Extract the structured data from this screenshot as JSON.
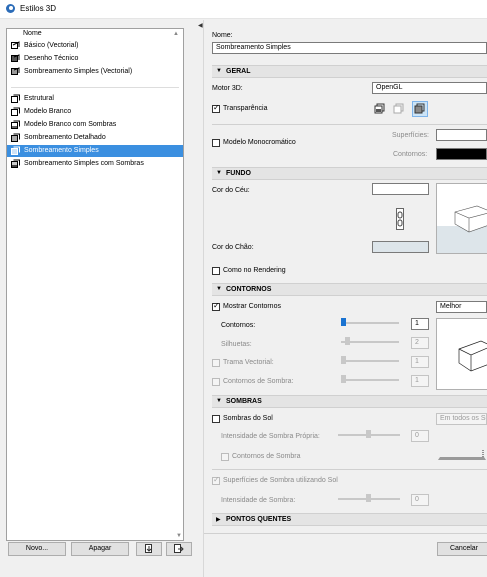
{
  "window": {
    "title": "Estilos 3D"
  },
  "sidebar": {
    "header": "Nome",
    "groups": [
      [
        {
          "label": "Básico (Vectorial)",
          "icon": "vector-style-icon"
        },
        {
          "label": "Desenho Técnico",
          "icon": "technical-drawing-icon"
        },
        {
          "label": "Sombreamento Simples (Vectorial)",
          "icon": "vector-shading-icon"
        }
      ],
      [
        {
          "label": "Estrutural",
          "icon": "structural-icon"
        },
        {
          "label": "Modelo Branco",
          "icon": "white-model-icon"
        },
        {
          "label": "Modelo Branco com Sombras",
          "icon": "white-model-shadows-icon"
        },
        {
          "label": "Sombreamento Detalhado",
          "icon": "detailed-shading-icon"
        },
        {
          "label": "Sombreamento Simples",
          "icon": "simple-shading-icon",
          "selected": true
        },
        {
          "label": "Sombreamento Simples com Sombras",
          "icon": "simple-shading-shadows-icon"
        }
      ]
    ],
    "buttons": {
      "new": "Novo...",
      "delete": "Apagar"
    }
  },
  "settings": {
    "name_label": "Nome:",
    "name_value": "Sombreamento Simples",
    "geral": {
      "title": "GERAL",
      "engine_label": "Motor 3D:",
      "engine_value": "OpenGL",
      "transparency_label": "Transparência",
      "transparency_checked": true,
      "mono_label": "Modelo Monocromático",
      "mono_checked": false,
      "surfaces_label": "Superfícies:",
      "contours_label": "Contornos:"
    },
    "fundo": {
      "title": "FUNDO",
      "sky_label": "Cor do Céu:",
      "ground_label": "Cor do Chão:",
      "as_rendering_label": "Como no Rendering"
    },
    "contornos": {
      "title": "CONTORNOS",
      "show_label": "Mostrar Contornos",
      "show_checked": true,
      "quality_value": "Melhor",
      "contours_label": "Contornos:",
      "contours_value": "1",
      "silhouettes_label": "Silhuetas:",
      "silhouettes_value": "2",
      "vector_hatch_label": "Trama Vectorial:",
      "vector_hatch_value": "1",
      "shadow_contours_label": "Contornos de Sombra:",
      "shadow_contours_value": "1"
    },
    "sombras": {
      "title": "SOMBRAS",
      "sun_shadows_label": "Sombras do Sol",
      "all_floors_value": "Em todos os Su",
      "own_shadow_label": "Intensidade de Sombra Própria:",
      "own_shadow_value": "0",
      "shadow_contours_label": "Contornos de Sombra",
      "shadow_surfaces_label": "Superfícies de Sombra utilizando Sol",
      "shadow_intensity_label": "Intensidade de Sombra:",
      "shadow_intensity_value": "0"
    },
    "hotspots": {
      "title": "PONTOS QUENTES"
    },
    "cancel_label": "Cancelar"
  }
}
